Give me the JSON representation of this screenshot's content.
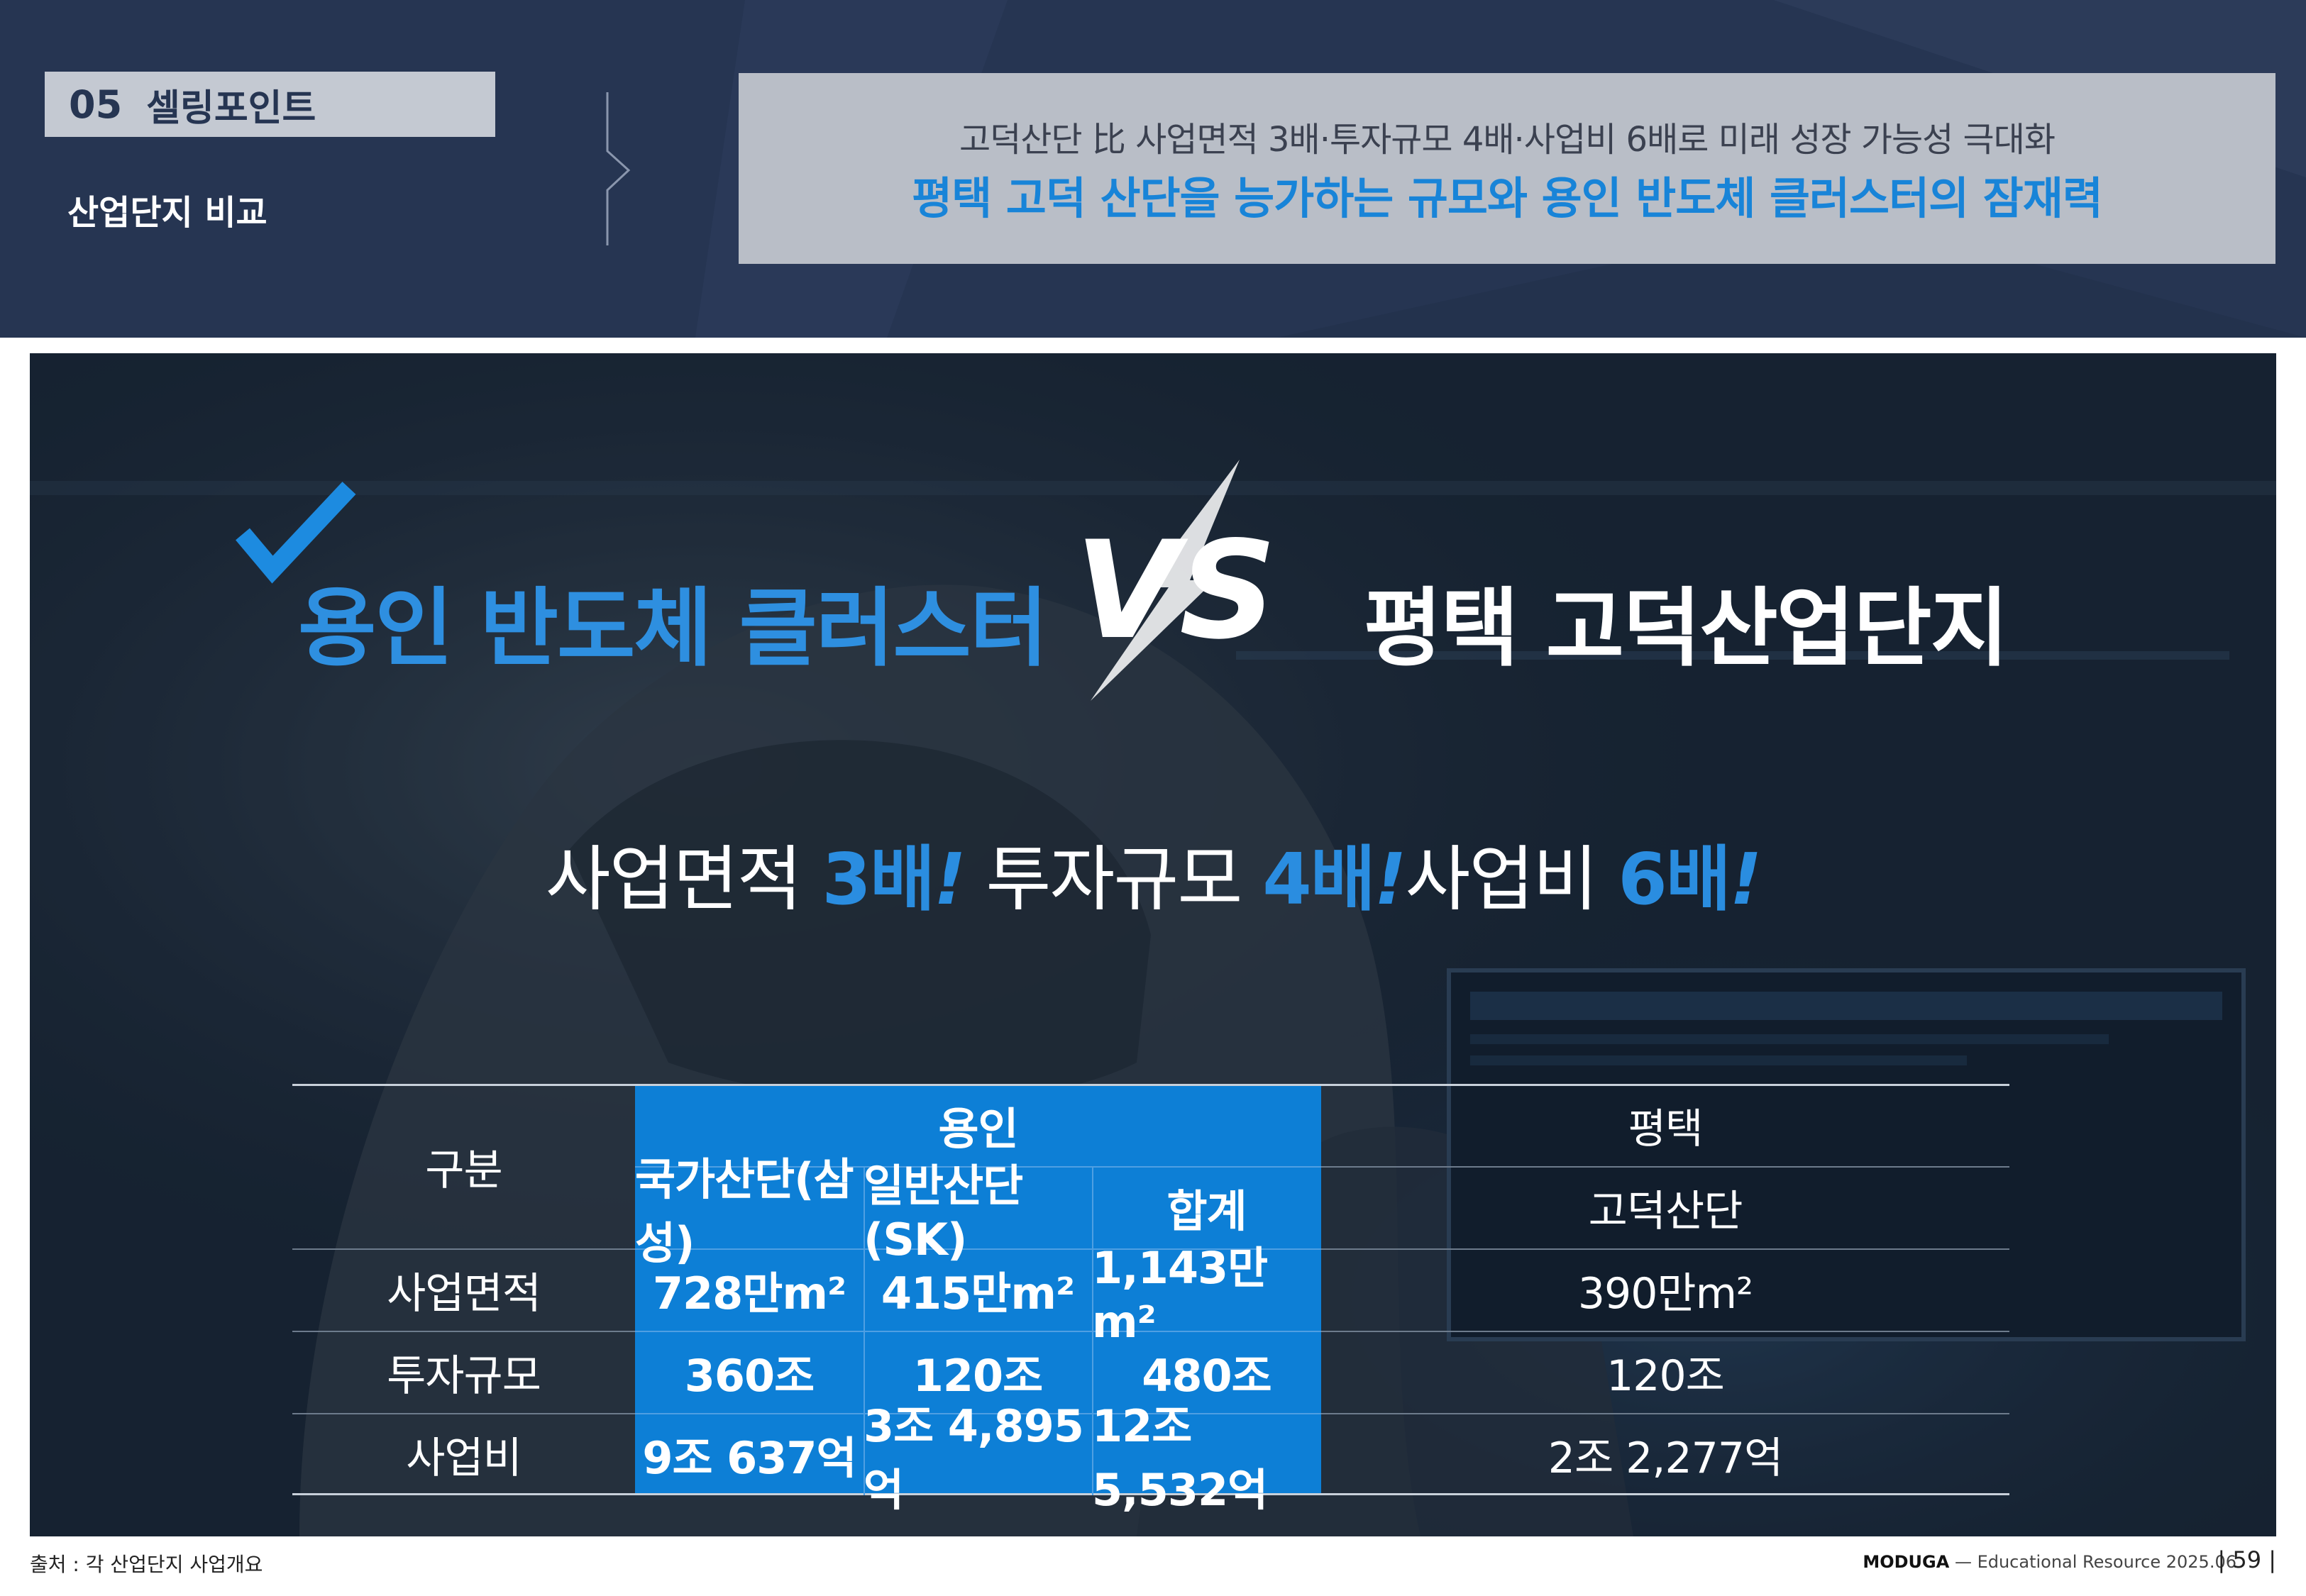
{
  "header": {
    "section_number": "05",
    "section_name": "셀링포인트",
    "section_subtitle": "산업단지 비교",
    "headline_sub": "고덕산단 比 사업면적 3배·투자규모 4배·사업비 6배로 미래 성장 가능성 극대화",
    "headline_main": "평택 고덕 산단을 능가하는 규모와 용인 반도체 클러스터의 잠재력"
  },
  "hero": {
    "left_title": "용인 반도체 클러스터",
    "vs_label": "VS",
    "right_title": "평택 고덕산업단지",
    "tagline": [
      {
        "label": "사업면적",
        "value": "3배",
        "mark": "!"
      },
      {
        "label": "투자규모",
        "value": "4배",
        "mark": "!"
      },
      {
        "label": "사업비",
        "value": "6배",
        "mark": "!"
      }
    ]
  },
  "table": {
    "row_header_label": "구분",
    "group_yongin": "용인",
    "group_pyeongtaek": "평택",
    "columns": [
      "국가산단(삼성)",
      "일반산단(SK)",
      "합계",
      "고덕산단"
    ],
    "rows": [
      {
        "label": "사업면적",
        "cells": [
          "728만m²",
          "415만m²",
          "1,143만m²",
          "390만m²"
        ]
      },
      {
        "label": "투자규모",
        "cells": [
          "360조",
          "120조",
          "480조",
          "120조"
        ]
      },
      {
        "label": "사업비",
        "cells": [
          "9조 637억",
          "3조 4,895억",
          "12조 5,532억",
          "2조 2,277억"
        ]
      }
    ]
  },
  "footer": {
    "source": "출처 : 각 산업단지 사업개요",
    "brand": "MODUGA",
    "brand_rest": "— Educational Resource 2025.06",
    "page": "59"
  },
  "colors": {
    "header_bg": "#263552",
    "accent_blue": "#1884d8",
    "table_blue": "#0d7fd6",
    "tag_gray": "#c4c9d2"
  }
}
